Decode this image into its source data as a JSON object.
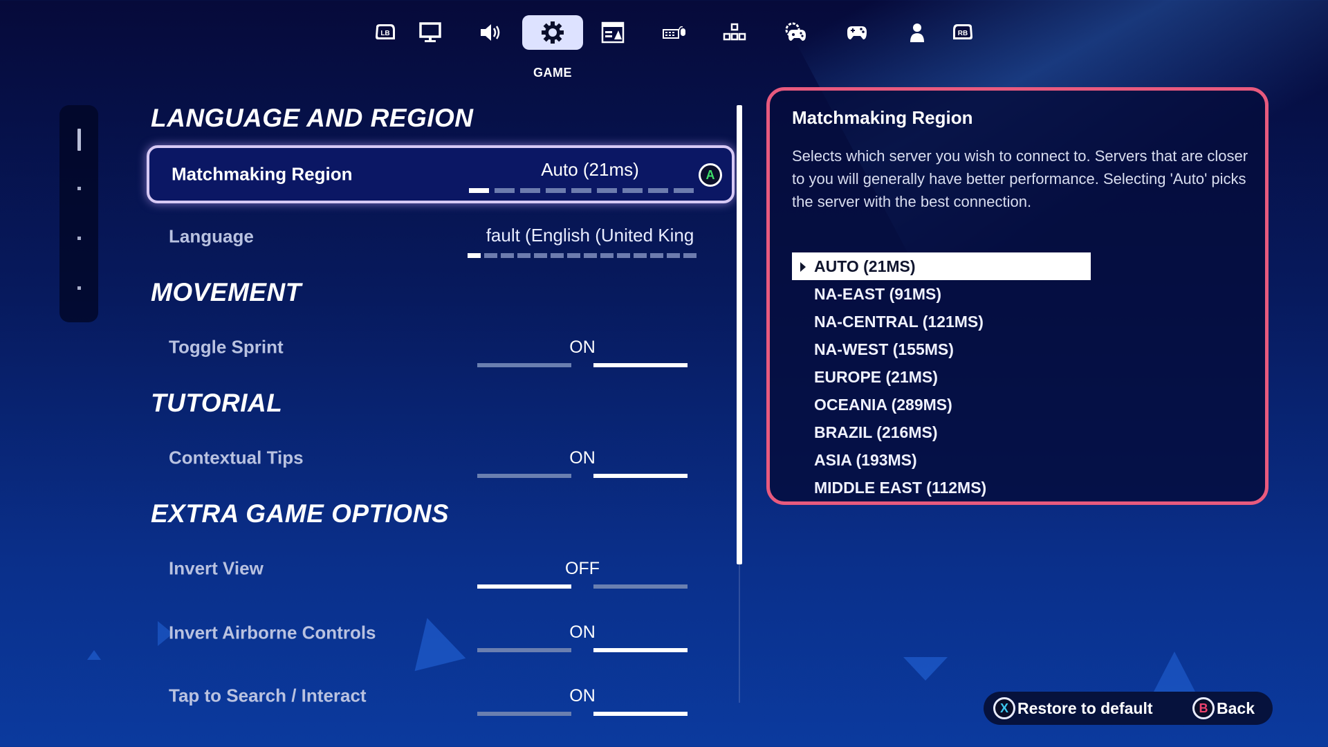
{
  "nav": {
    "tabs": [
      {
        "name": "lb-bumper",
        "icon": "lb-bumper-icon"
      },
      {
        "name": "display",
        "icon": "monitor-icon"
      },
      {
        "name": "audio",
        "icon": "speaker-icon"
      },
      {
        "name": "game",
        "icon": "gear-icon",
        "active": true
      },
      {
        "name": "accessibility",
        "icon": "window-ui-icon"
      },
      {
        "name": "keyboard-mouse",
        "icon": "keyboard-mouse-icon"
      },
      {
        "name": "touch-controls",
        "icon": "dpad-keys-icon"
      },
      {
        "name": "controller-settings",
        "icon": "gear-controller-icon"
      },
      {
        "name": "controller",
        "icon": "controller-icon"
      },
      {
        "name": "account",
        "icon": "person-icon"
      },
      {
        "name": "rb-bumper",
        "icon": "rb-bumper-icon"
      }
    ],
    "active_label": "GAME",
    "lb_text": "LB",
    "rb_text": "RB"
  },
  "pager": {
    "pages": 4,
    "current": 1
  },
  "sections": {
    "language_region": "LANGUAGE AND REGION",
    "movement": "MOVEMENT",
    "tutorial": "TUTORIAL",
    "extra": "EXTRA GAME OPTIONS"
  },
  "settings": {
    "matchmaking": {
      "label": "Matchmaking Region",
      "value": "Auto (21ms)",
      "segments": 9,
      "selected_index": 0,
      "confirm_button": "A"
    },
    "language": {
      "label": "Language",
      "value": "fault (English (United King",
      "segments": 14,
      "selected_index": 0
    },
    "toggle_sprint": {
      "label": "Toggle Sprint",
      "value": "ON"
    },
    "contextual_tips": {
      "label": "Contextual Tips",
      "value": "ON"
    },
    "invert_view": {
      "label": "Invert View",
      "value": "OFF"
    },
    "invert_airborne": {
      "label": "Invert Airborne Controls",
      "value": "ON"
    },
    "tap_to_search": {
      "label": "Tap to Search / Interact",
      "value": "ON"
    }
  },
  "panel": {
    "title": "Matchmaking Region",
    "description": "Selects which server you wish to connect to. Servers that are closer to you will generally have better performance. Selecting 'Auto' picks the server with the best connection.",
    "options": [
      "AUTO (21MS)",
      "NA-EAST (91MS)",
      "NA-CENTRAL (121MS)",
      "NA-WEST (155MS)",
      "EUROPE (21MS)",
      "OCEANIA (289MS)",
      "BRAZIL (216MS)",
      "ASIA (193MS)",
      "MIDDLE EAST (112MS)"
    ],
    "selected_option": 0
  },
  "footer": {
    "restore": {
      "button": "X",
      "label": "Restore to default",
      "color": "#3cc8f0"
    },
    "back": {
      "button": "B",
      "label": "Back",
      "color": "#f0426e"
    }
  },
  "colors": {
    "panel_border": "#e85a7e",
    "accent_green": "#3ee06a"
  }
}
